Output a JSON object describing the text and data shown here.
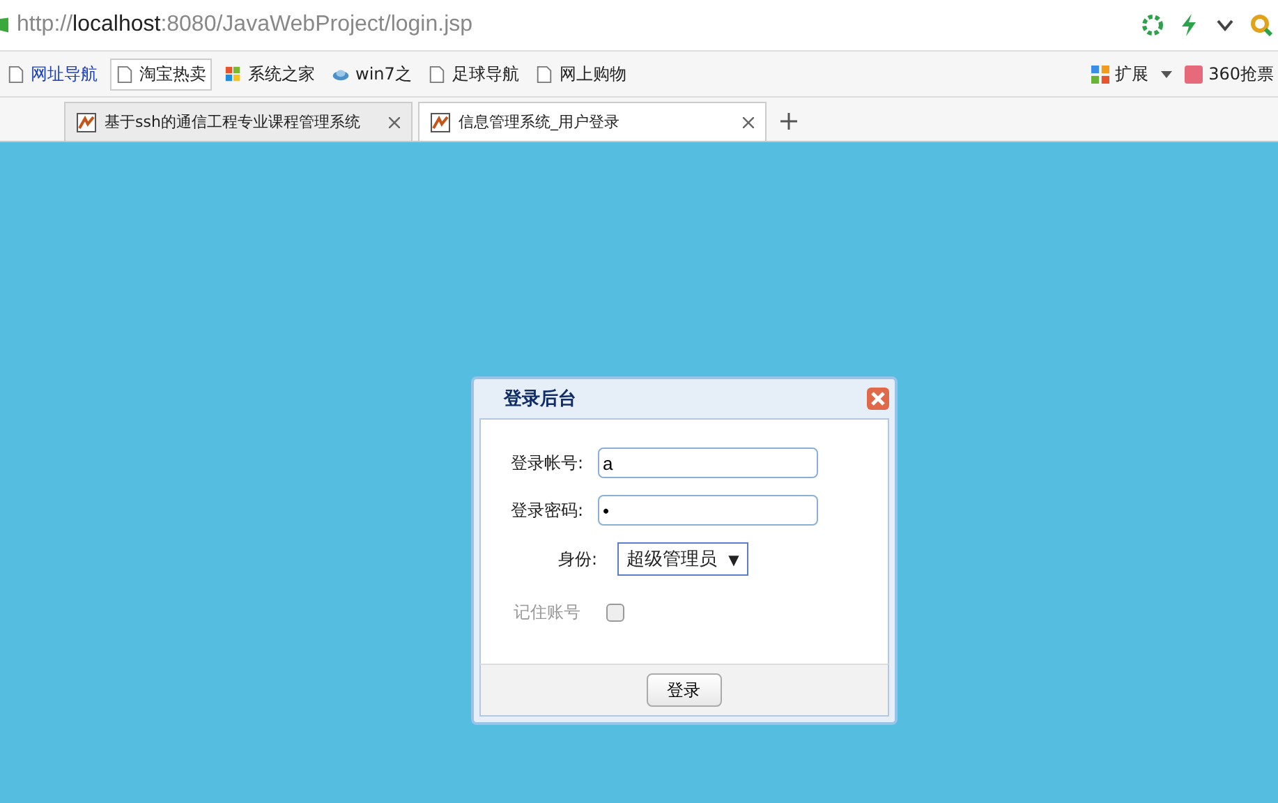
{
  "address_bar": {
    "scheme": "http://",
    "host": "localhost",
    "rest": ":8080/JavaWebProject/login.jsp"
  },
  "bookmarks": [
    {
      "label": "网址导航",
      "kind": "link"
    },
    {
      "label": "淘宝热卖",
      "kind": "page"
    },
    {
      "label": "系统之家",
      "kind": "windows"
    },
    {
      "label": "win7之",
      "kind": "cloud"
    },
    {
      "label": "足球导航",
      "kind": "page"
    },
    {
      "label": "网上购物",
      "kind": "page"
    }
  ],
  "extensions": {
    "label": "扩展"
  },
  "toolbar_right": {
    "label": "360抢票"
  },
  "tabs": [
    {
      "title": "基于ssh的通信工程专业课程管理系统",
      "selected": false
    },
    {
      "title": "信息管理系统_用户登录",
      "selected": true
    }
  ],
  "dialog": {
    "title": "登录后台",
    "account": {
      "label": "登录帐号:",
      "value": "a"
    },
    "password": {
      "label": "登录密码:",
      "value": "•"
    },
    "role": {
      "label": "身份:",
      "value": "超级管理员",
      "arrow": "▼"
    },
    "remember": {
      "label": "记住账号",
      "checked": false
    },
    "login_button": "登录"
  }
}
